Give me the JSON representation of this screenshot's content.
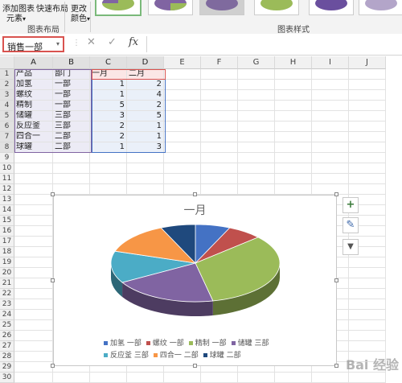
{
  "ribbon": {
    "add_element_label_1": "添加图表",
    "add_element_label_2": "元素",
    "quick_layout_label": "快速布局",
    "change_color_label_1": "更改",
    "change_color_label_2": "颜色",
    "group_layout": "图表布局",
    "group_styles": "图表样式",
    "dropdown_glyph": "▾"
  },
  "formula_bar": {
    "name_box": "销售一部",
    "name_box_dropdown": "▾",
    "cancel_icon": "✕",
    "enter_icon": "✓",
    "fx_label": "fx",
    "formula": ""
  },
  "sheet": {
    "columns": [
      "A",
      "B",
      "C",
      "D",
      "E",
      "F",
      "G",
      "H",
      "I",
      "J"
    ],
    "rows": [
      "1",
      "2",
      "3",
      "4",
      "5",
      "6",
      "7",
      "8",
      "9",
      "10",
      "11",
      "12",
      "13",
      "14",
      "15",
      "16",
      "17",
      "18",
      "19",
      "20",
      "21",
      "22",
      "23",
      "24",
      "25",
      "26",
      "27",
      "28",
      "29",
      "30"
    ],
    "headers": [
      "产品",
      "部门",
      "一月",
      "二月"
    ],
    "data": [
      [
        "加氢",
        "一部",
        "1",
        "2"
      ],
      [
        "螺纹",
        "一部",
        "1",
        "4"
      ],
      [
        "精制",
        "一部",
        "5",
        "2"
      ],
      [
        "储罐",
        "三部",
        "3",
        "5"
      ],
      [
        "反应釜",
        "三部",
        "2",
        "1"
      ],
      [
        "四合一",
        "二部",
        "2",
        "1"
      ],
      [
        "球罐",
        "二部",
        "1",
        "3"
      ]
    ]
  },
  "chart_data": {
    "type": "pie",
    "title": "一月",
    "categories": [
      "加氢 一部",
      "螺纹 一部",
      "精制 一部",
      "储罐 三部",
      "反应釜 三部",
      "四合一 二部",
      "球罐 二部"
    ],
    "values": [
      1,
      1,
      5,
      3,
      2,
      2,
      1
    ],
    "colors": [
      "#4472c4",
      "#c0504d",
      "#9bbb59",
      "#8064a2",
      "#4bacc6",
      "#f79646",
      "#1f497d"
    ],
    "style": "3d",
    "legend": "bottom"
  },
  "chart_tools": {
    "add_icon": "+",
    "style_icon": "✎",
    "filter_icon": "▼"
  },
  "watermark": "Bai 经验"
}
